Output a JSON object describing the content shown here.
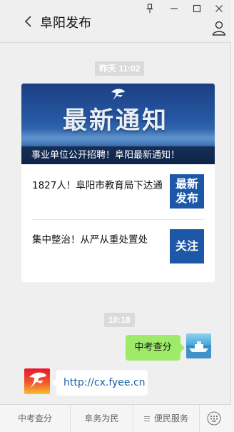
{
  "window": {
    "title": "阜阳发布",
    "controls": [
      "pin-icon",
      "minimize-icon",
      "maximize-icon",
      "close-icon"
    ]
  },
  "messages": {
    "article_card": {
      "timestamp": "昨天 11:02",
      "banner_heading": "最新通知",
      "banner_caption": "事业单位公开招聘！阜阳最新通知！",
      "items": [
        {
          "title": "1827人！阜阳市教育局下达通",
          "thumb_line1": "最新",
          "thumb_line2": "发布"
        },
        {
          "title": "集中整治！从严从重处置处",
          "thumb_line1": "关注",
          "thumb_line2": ""
        }
      ]
    },
    "user_message": {
      "timestamp": "10:18",
      "text": "中考查分"
    },
    "bot_reply": {
      "text": "http://cx.fyee.cn"
    }
  },
  "menu": {
    "items": [
      "中考查分",
      "阜务为民",
      "便民服务"
    ],
    "keyboard_icon": "keyboard-icon"
  },
  "colors": {
    "accent_blue": "#1d57a8",
    "sent_bubble": "#9eea6a",
    "link": "#1d5fa8"
  }
}
